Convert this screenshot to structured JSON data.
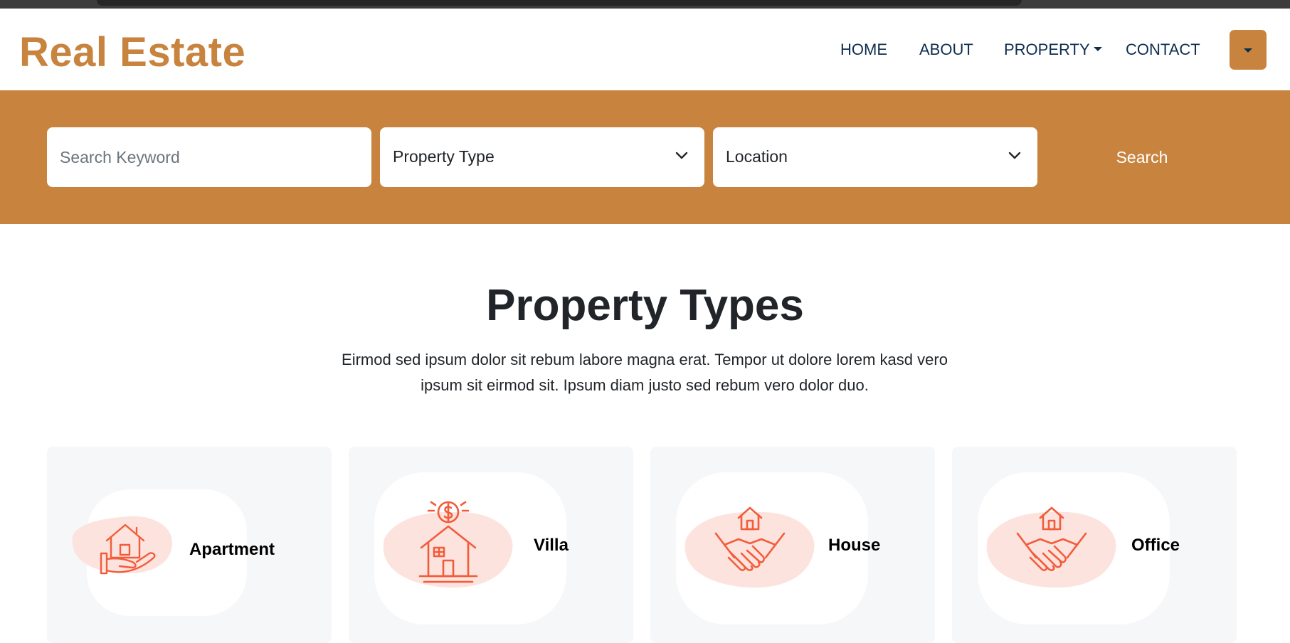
{
  "brand": "Real Estate",
  "nav": {
    "home": "HOME",
    "about": "ABOUT",
    "property": "PROPERTY",
    "contact": "CONTACT"
  },
  "search": {
    "keyword_placeholder": "Search Keyword",
    "property_type": "Property Type",
    "location": "Location",
    "button": "Search"
  },
  "section": {
    "title": "Property Types",
    "description": "Eirmod sed ipsum dolor sit rebum labore magna erat. Tempor ut dolore lorem kasd vero ipsum sit eirmod sit. Ipsum diam justo sed rebum vero dolor duo."
  },
  "property_types": [
    {
      "label": "Apartment",
      "icon": "house-in-hand-icon"
    },
    {
      "label": "Villa",
      "icon": "house-dollar-icon"
    },
    {
      "label": "House",
      "icon": "handshake-house-icon"
    },
    {
      "label": "Office",
      "icon": "handshake-house-icon"
    }
  ],
  "colors": {
    "brand": "#c8843f",
    "nav_text": "#0e2e50",
    "icon_stroke": "#f25c3b",
    "icon_splash": "#fde3de",
    "card_bg": "#f6f7f9"
  }
}
